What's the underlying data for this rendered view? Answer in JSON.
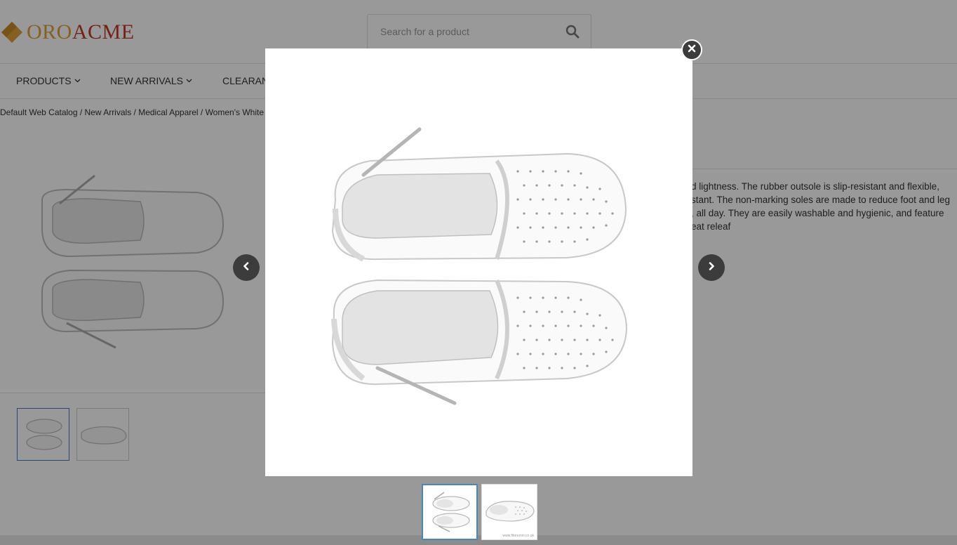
{
  "header": {
    "logo": {
      "part1": "ORO",
      "part2": "ACME"
    },
    "search": {
      "placeholder": "Search for a product"
    }
  },
  "nav": {
    "items": [
      {
        "label": "PRODUCTS"
      },
      {
        "label": "NEW ARRIVALS"
      },
      {
        "label": "CLEARAN"
      }
    ]
  },
  "breadcrumb": "Default Web Catalog / New Arrivals / Medical Apparel / Women's White S",
  "description": {
    "lines": [
      "d lightness. The rubber outsole is slip-resistant and flexible,",
      "stant. The non-marking soles are made to reduce foot and leg",
      ", all day. They are easily washable and hygienic, and feature",
      "eat releaf"
    ]
  },
  "lightbox": {
    "thumbnail_watermark": "www.fitoremin.co.uk"
  },
  "colors": {
    "logo_gold": "#e0a13a",
    "logo_red": "#c0392b",
    "active_thumb_border": "#4a86b8",
    "overlay": "rgba(0,0,0,0.4)",
    "control_bg": "#3c3c3c"
  },
  "icons": {
    "search": "search-icon",
    "close": "close-icon",
    "prev": "chevron-left-icon",
    "next": "chevron-right-icon",
    "nav_caret": "chevron-down-icon"
  }
}
